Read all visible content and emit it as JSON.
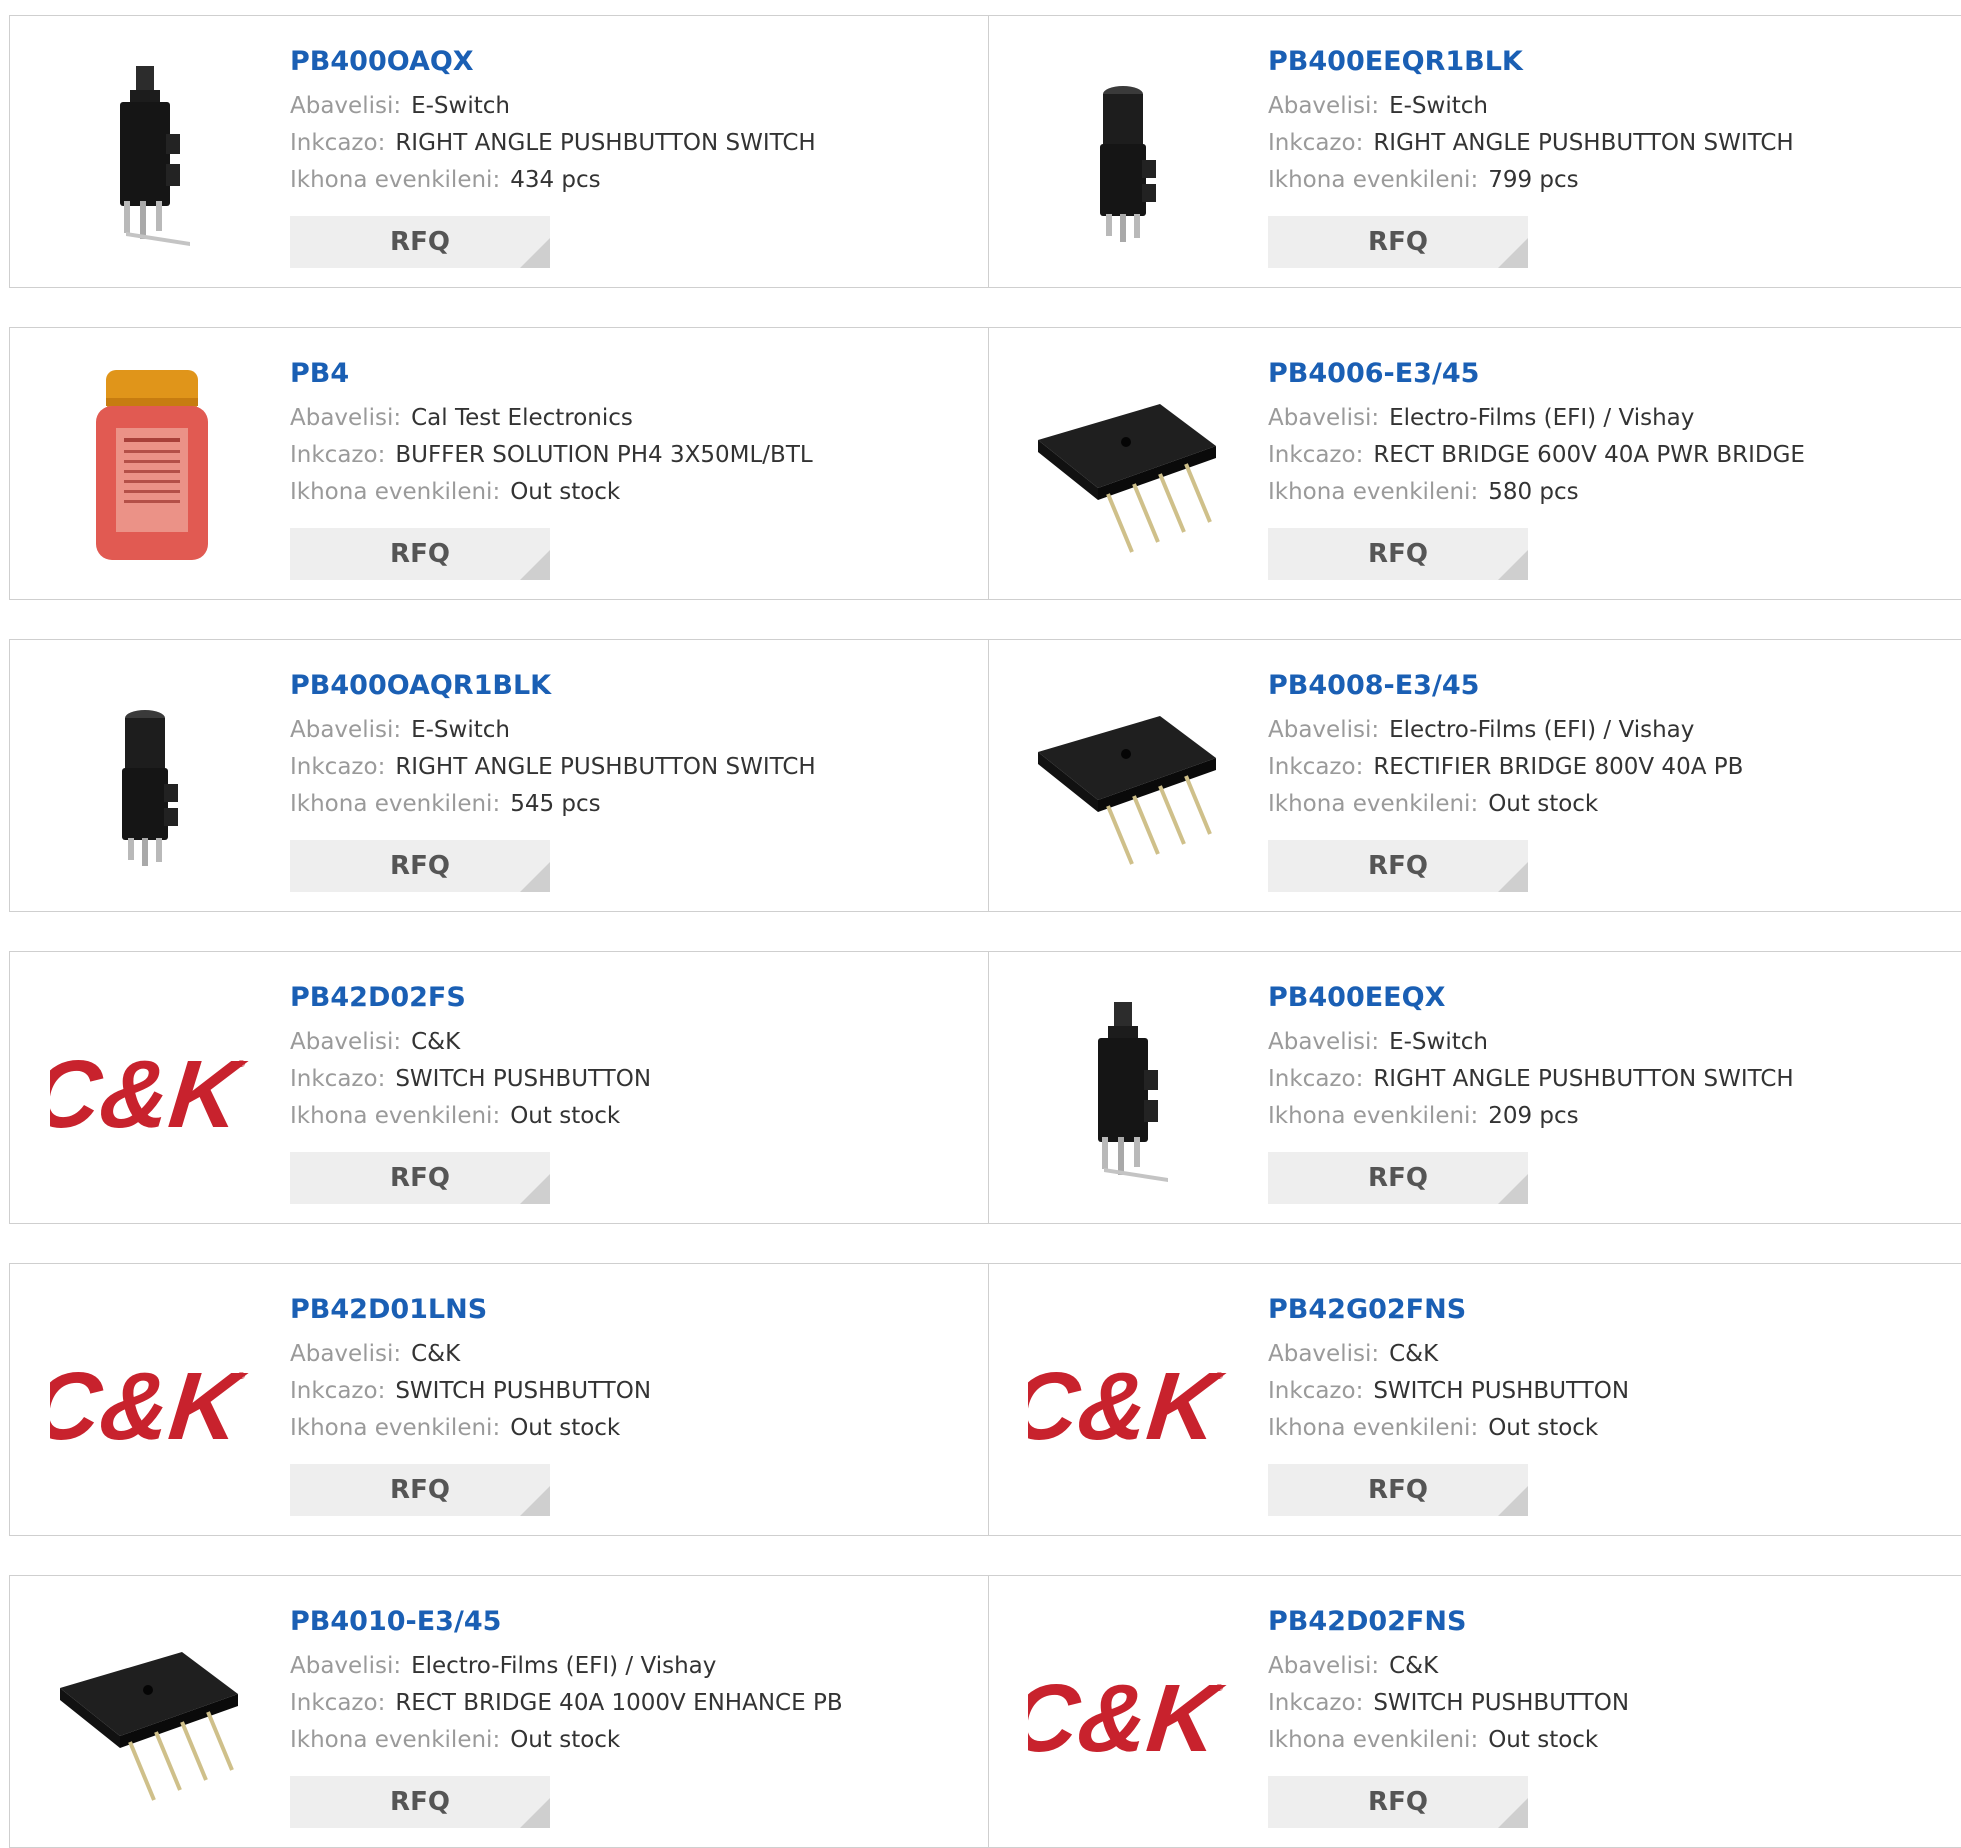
{
  "labels": {
    "vendor": "Abavelisi:",
    "description": "Inkcazo:",
    "stock": "Ikhona evenkileni:",
    "rfq": "RFQ"
  },
  "colors": {
    "link": "#1a5fb4",
    "label": "#9a9a9a",
    "value": "#333333",
    "border": "#cfcfcf",
    "ck_red": "#c8222d"
  },
  "products": [
    {
      "part": "PB400OAQX",
      "vendor": "E-Switch",
      "description": "RIGHT ANGLE PUSHBUTTON SWITCH",
      "stock": "434 pcs",
      "image": "pushbutton-switch-tall"
    },
    {
      "part": "PB400EEQR1BLK",
      "vendor": "E-Switch",
      "description": "RIGHT ANGLE PUSHBUTTON SWITCH",
      "stock": "799 pcs",
      "image": "pushbutton-switch-round"
    },
    {
      "part": "PB4",
      "vendor": "Cal Test Electronics",
      "description": "BUFFER SOLUTION PH4 3X50ML/BTL",
      "stock": "Out stock",
      "image": "buffer-bottle"
    },
    {
      "part": "PB4006-E3/45",
      "vendor": "Electro-Films (EFI) / Vishay",
      "description": "RECT BRIDGE 600V 40A PWR BRIDGE",
      "stock": "580 pcs",
      "image": "bridge-rectifier"
    },
    {
      "part": "PB400OAQR1BLK",
      "vendor": "E-Switch",
      "description": "RIGHT ANGLE PUSHBUTTON SWITCH",
      "stock": "545 pcs",
      "image": "pushbutton-switch-round"
    },
    {
      "part": "PB4008-E3/45",
      "vendor": "Electro-Films (EFI) / Vishay",
      "description": "RECTIFIER BRIDGE 800V 40A PB",
      "stock": "Out stock",
      "image": "bridge-rectifier"
    },
    {
      "part": "PB42D02FS",
      "vendor": "C&K",
      "description": "SWITCH PUSHBUTTON",
      "stock": "Out stock",
      "image": "ck-logo"
    },
    {
      "part": "PB400EEQX",
      "vendor": "E-Switch",
      "description": "RIGHT ANGLE PUSHBUTTON SWITCH",
      "stock": "209 pcs",
      "image": "pushbutton-switch-tall"
    },
    {
      "part": "PB42D01LNS",
      "vendor": "C&K",
      "description": "SWITCH PUSHBUTTON",
      "stock": "Out stock",
      "image": "ck-logo"
    },
    {
      "part": "PB42G02FNS",
      "vendor": "C&K",
      "description": "SWITCH PUSHBUTTON",
      "stock": "Out stock",
      "image": "ck-logo"
    },
    {
      "part": "PB4010-E3/45",
      "vendor": "Electro-Films (EFI) / Vishay",
      "description": "RECT BRIDGE 40A 1000V ENHANCE PB",
      "stock": "Out stock",
      "image": "bridge-rectifier"
    },
    {
      "part": "PB42D02FNS",
      "vendor": "C&K",
      "description": "SWITCH PUSHBUTTON",
      "stock": "Out stock",
      "image": "ck-logo"
    }
  ]
}
